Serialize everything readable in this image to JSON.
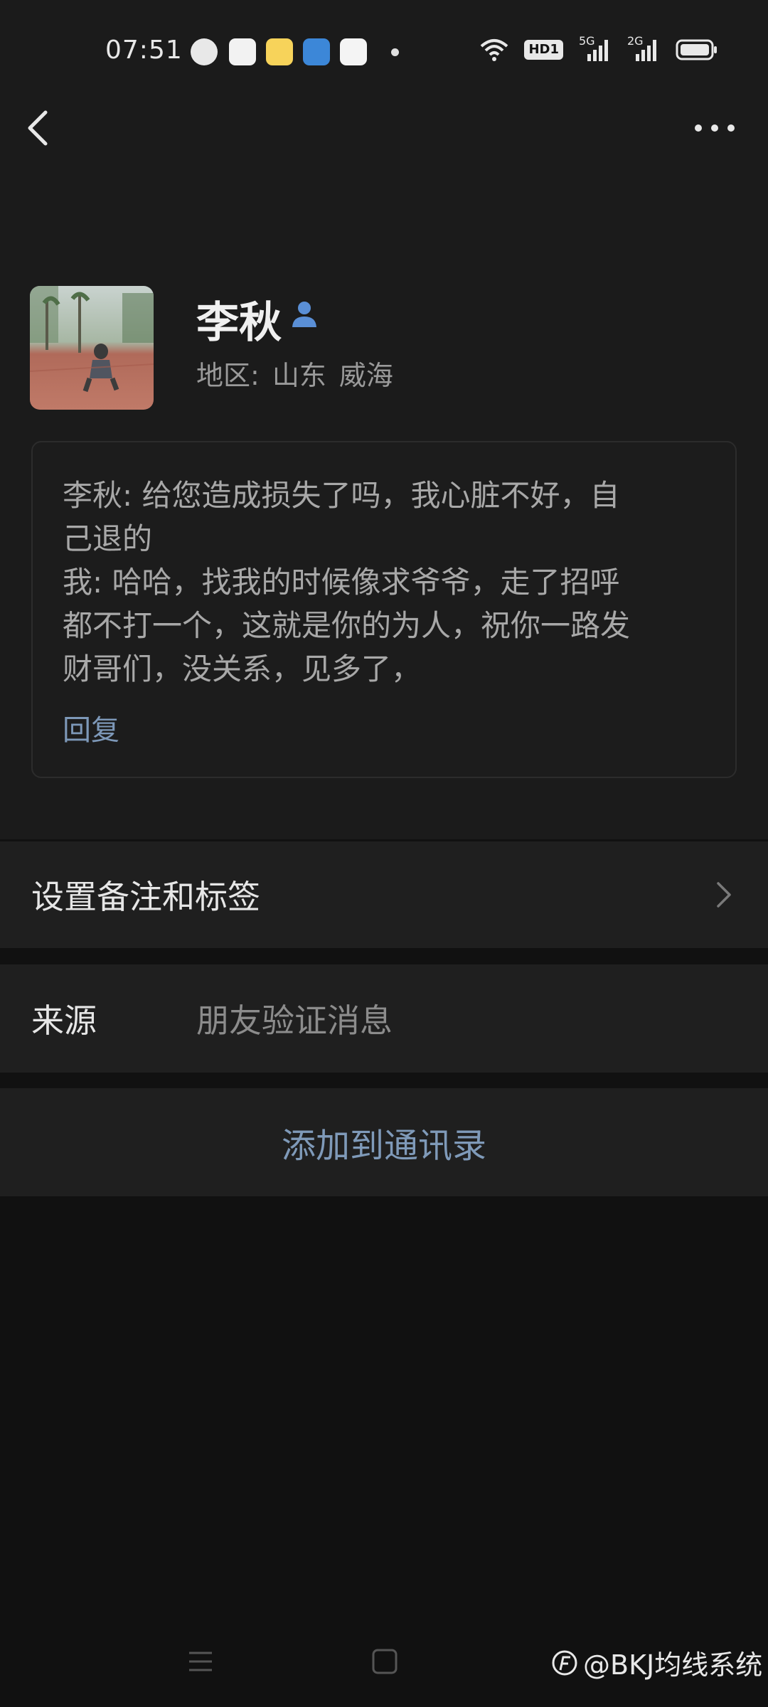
{
  "status_bar": {
    "time": "07:51",
    "signal_1_label": "5G",
    "signal_2_label": "2G",
    "hd_label": "HD1"
  },
  "nav": {
    "back_icon": "chevron-left-icon",
    "more_icon": "more-dots-icon"
  },
  "profile": {
    "name": "李秋",
    "region_label": "地区:",
    "region_province": "山东",
    "region_city": "威海"
  },
  "message": {
    "lines": [
      "李秋: 给您造成损失了吗，我心脏不好，自",
      "己退的",
      "我: 哈哈，找我的时候像求爷爷，走了招呼",
      "都不打一个，这就是你的为人，祝你一路发",
      "财哥们，没关系，见多了，"
    ],
    "reply_label": "回复"
  },
  "rows": {
    "notes_label": "设置备注和标签",
    "source_label": "来源",
    "source_value": "朋友验证消息",
    "add_contact_label": "添加到通讯录"
  },
  "watermark": {
    "text": "@BKJ均线系统"
  },
  "colors": {
    "background": "#111111",
    "panel": "#1b1b1b",
    "row": "#1f1f1f",
    "link": "#7d98b8"
  }
}
